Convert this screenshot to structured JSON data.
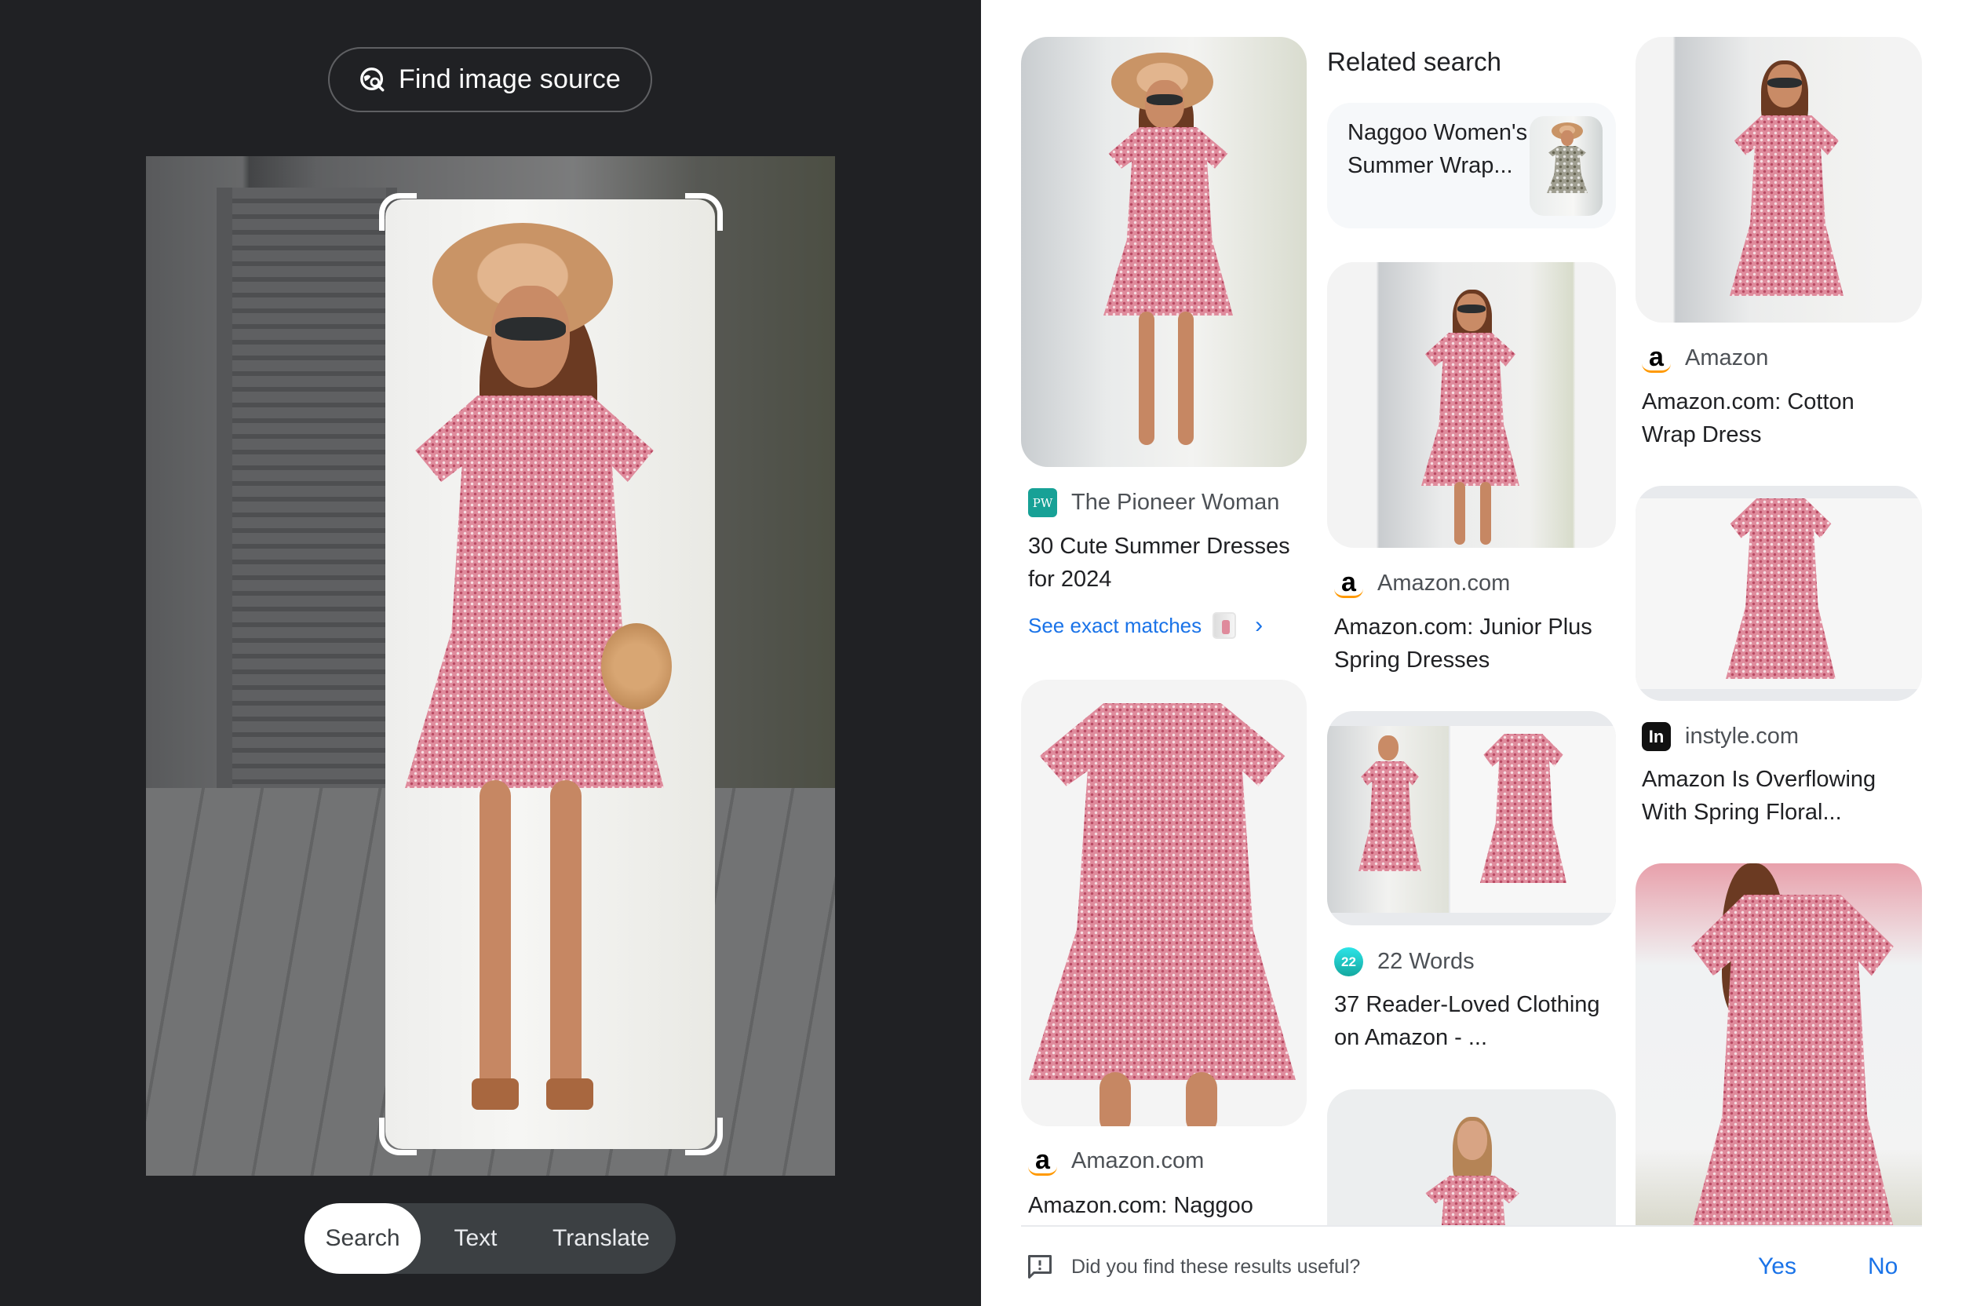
{
  "left_panel": {
    "find_source_button": {
      "label": "Find image source",
      "icon": "image-search-icon"
    },
    "modes": [
      {
        "label": "Search",
        "active": true
      },
      {
        "label": "Text",
        "active": false
      },
      {
        "label": "Translate",
        "active": false
      }
    ]
  },
  "results": {
    "related_heading": "Related search",
    "related_card": {
      "text": "Naggoo Women's Summer Wrap..."
    },
    "items": [
      {
        "source": "The Pioneer Woman",
        "source_icon": "pioneer-woman-logo",
        "title": "30 Cute Summer Dresses for 2024",
        "link": "See exact matches"
      },
      {
        "source": "Amazon",
        "source_icon": "amazon-logo",
        "title": "Amazon.com: Cotton Wrap Dress"
      },
      {
        "source": "Amazon.com",
        "source_icon": "amazon-logo",
        "title": "Amazon.com: Junior Plus Spring Dresses"
      },
      {
        "source": "instyle.com",
        "source_icon": "instyle-logo",
        "title": "Amazon Is Overflowing With Spring Floral..."
      },
      {
        "source": "22 Words",
        "source_icon": "22-words-logo",
        "title": "37 Reader-Loved Clothing on Amazon - ..."
      },
      {
        "source": "Amazon.com",
        "source_icon": "amazon-logo",
        "title": "Amazon.com: Naggoo"
      }
    ]
  },
  "feedback": {
    "question": "Did you find these results useful?",
    "yes_label": "Yes",
    "no_label": "No"
  },
  "colors": {
    "dark_bg": "#202124",
    "link_blue": "#1a73e8",
    "segment_bg": "#3c4043"
  }
}
